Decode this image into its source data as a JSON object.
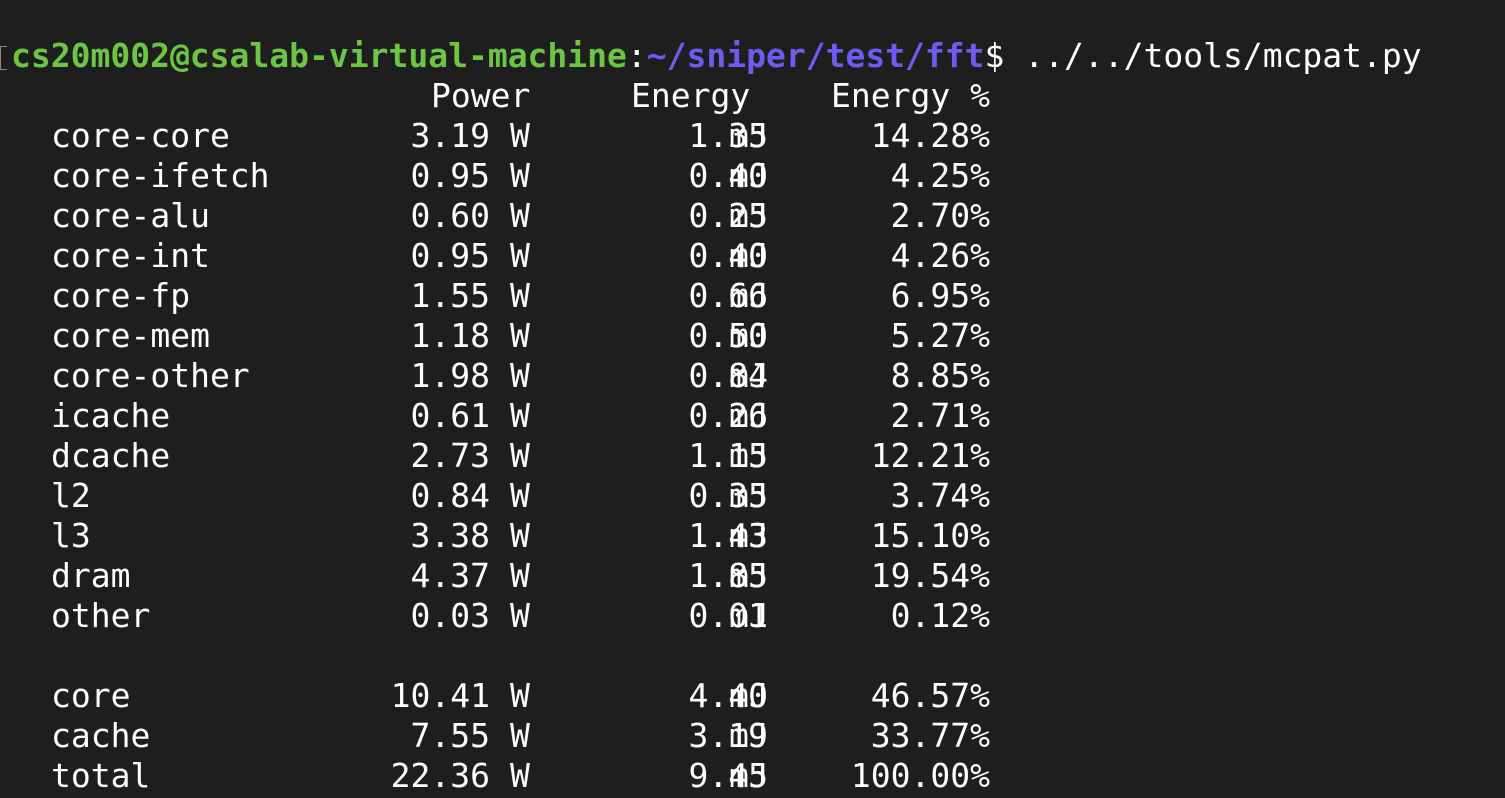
{
  "prompt": {
    "user_host": "cs20m002@csalab-virtual-machine",
    "separator": ":",
    "path": "~/sniper/test/fft",
    "dollar": "$",
    "command": " ../../tools/mcpat.py"
  },
  "headers": {
    "power": "Power",
    "energy": "Energy",
    "energy_pct": "Energy %"
  },
  "rows": [
    {
      "name": "core-core",
      "power": "3.19",
      "power_unit": "W",
      "energy": "1.35",
      "energy_unit": "mJ",
      "pct": "14.28%"
    },
    {
      "name": "core-ifetch",
      "power": "0.95",
      "power_unit": "W",
      "energy": "0.40",
      "energy_unit": "mJ",
      "pct": "4.25%"
    },
    {
      "name": "core-alu",
      "power": "0.60",
      "power_unit": "W",
      "energy": "0.25",
      "energy_unit": "mJ",
      "pct": "2.70%"
    },
    {
      "name": "core-int",
      "power": "0.95",
      "power_unit": "W",
      "energy": "0.40",
      "energy_unit": "mJ",
      "pct": "4.26%"
    },
    {
      "name": "core-fp",
      "power": "1.55",
      "power_unit": "W",
      "energy": "0.66",
      "energy_unit": "mJ",
      "pct": "6.95%"
    },
    {
      "name": "core-mem",
      "power": "1.18",
      "power_unit": "W",
      "energy": "0.50",
      "energy_unit": "mJ",
      "pct": "5.27%"
    },
    {
      "name": "core-other",
      "power": "1.98",
      "power_unit": "W",
      "energy": "0.84",
      "energy_unit": "mJ",
      "pct": "8.85%"
    },
    {
      "name": "icache",
      "power": "0.61",
      "power_unit": "W",
      "energy": "0.26",
      "energy_unit": "mJ",
      "pct": "2.71%"
    },
    {
      "name": "dcache",
      "power": "2.73",
      "power_unit": "W",
      "energy": "1.15",
      "energy_unit": "mJ",
      "pct": "12.21%"
    },
    {
      "name": "l2",
      "power": "0.84",
      "power_unit": "W",
      "energy": "0.35",
      "energy_unit": "mJ",
      "pct": "3.74%"
    },
    {
      "name": "l3",
      "power": "3.38",
      "power_unit": "W",
      "energy": "1.43",
      "energy_unit": "mJ",
      "pct": "15.10%"
    },
    {
      "name": "dram",
      "power": "4.37",
      "power_unit": "W",
      "energy": "1.85",
      "energy_unit": "mJ",
      "pct": "19.54%"
    },
    {
      "name": "other",
      "power": "0.03",
      "power_unit": "W",
      "energy": "0.01",
      "energy_unit": "mJ",
      "pct": "0.12%"
    }
  ],
  "summary": [
    {
      "name": "core",
      "power": "10.41",
      "power_unit": "W",
      "energy": "4.40",
      "energy_unit": "mJ",
      "pct": "46.57%"
    },
    {
      "name": "cache",
      "power": "7.55",
      "power_unit": "W",
      "energy": "3.19",
      "energy_unit": "mJ",
      "pct": "33.77%"
    },
    {
      "name": "total",
      "power": "22.36",
      "power_unit": "W",
      "energy": "9.45",
      "energy_unit": "mJ",
      "pct": "100.00%"
    }
  ],
  "colors": {
    "background": "#1e1e1e",
    "user_host": "#6cc644",
    "path": "#6e5cf0",
    "text": "#ffffff"
  }
}
